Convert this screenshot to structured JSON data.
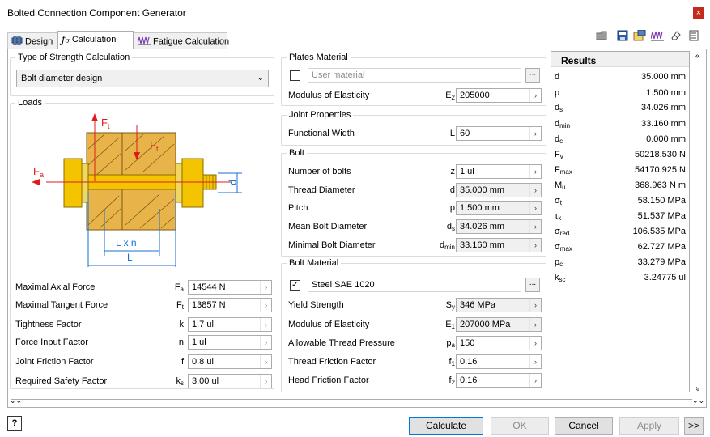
{
  "window": {
    "title": "Bolted Connection Component Generator",
    "close_icon": "×"
  },
  "tabs": [
    {
      "label": "Design",
      "icon": "design-icon"
    },
    {
      "label": "Calculation",
      "icon": "calculation-icon"
    },
    {
      "label": "Fatigue Calculation",
      "icon": "fatigue-icon"
    }
  ],
  "strength": {
    "legend": "Type of Strength Calculation",
    "selected": "Bolt diameter design"
  },
  "loads": {
    "legend": "Loads",
    "diagram": {
      "ft_top": "F",
      "ft_top_sub": "t",
      "ft_right": "F",
      "ft_right_sub": "t",
      "fa": "F",
      "fa_sub": "a",
      "p": "p",
      "lxn": "L x n",
      "l": "L"
    },
    "rows": [
      {
        "label": "Maximal Axial Force",
        "sym": "F",
        "sub": "a",
        "value": "14544 N"
      },
      {
        "label": "Maximal Tangent Force",
        "sym": "F",
        "sub": "t",
        "value": "13857 N"
      },
      {
        "label": "Tightness Factor",
        "sym": "k",
        "sub": "",
        "value": "1.7 ul"
      },
      {
        "label": "Force Input Factor",
        "sym": "n",
        "sub": "",
        "value": "1 ul"
      },
      {
        "label": "Joint Friction Factor",
        "sym": "f",
        "sub": "",
        "value": "0.8 ul"
      },
      {
        "label": "Required Safety Factor",
        "sym": "k",
        "sub": "s",
        "value": "3.00 ul"
      }
    ]
  },
  "plates": {
    "legend": "Plates Material",
    "material_placeholder": "User material",
    "modulus_label": "Modulus of Elasticity",
    "modulus_sym": "E",
    "modulus_sub": "2",
    "modulus_value": "205000"
  },
  "joint": {
    "legend": "Joint Properties",
    "label": "Functional Width",
    "sym": "L",
    "value": "60"
  },
  "bolt": {
    "legend": "Bolt",
    "rows": [
      {
        "label": "Number of bolts",
        "sym": "z",
        "sub": "",
        "value": "1 ul",
        "ro": false
      },
      {
        "label": "Thread Diameter",
        "sym": "d",
        "sub": "",
        "value": "35.000 mm",
        "ro": true
      },
      {
        "label": "Pitch",
        "sym": "p",
        "sub": "",
        "value": "1.500 mm",
        "ro": true
      },
      {
        "label": "Mean Bolt Diameter",
        "sym": "d",
        "sub": "s",
        "value": "34.026 mm",
        "ro": true
      },
      {
        "label": "Minimal Bolt Diameter",
        "sym": "d",
        "sub": "min",
        "value": "33.160 mm",
        "ro": true
      }
    ]
  },
  "bolt_material": {
    "legend": "Bolt Material",
    "material": "Steel SAE 1020",
    "rows": [
      {
        "label": "Yield Strength",
        "sym": "S",
        "sub": "y",
        "value": "346 MPa",
        "ro": true
      },
      {
        "label": "Modulus of Elasticity",
        "sym": "E",
        "sub": "1",
        "value": "207000 MPa",
        "ro": true
      },
      {
        "label": "Allowable Thread Pressure",
        "sym": "p",
        "sub": "a",
        "value": "150",
        "ro": false
      },
      {
        "label": "Thread Friction Factor",
        "sym": "f",
        "sub": "1",
        "value": "0.16",
        "ro": false
      },
      {
        "label": "Head Friction Factor",
        "sym": "f",
        "sub": "2",
        "value": "0.16",
        "ro": false
      }
    ]
  },
  "results": {
    "title": "Results",
    "rows": [
      {
        "sym": "d",
        "sub": "",
        "value": "35.000 mm"
      },
      {
        "sym": "p",
        "sub": "",
        "value": "1.500 mm"
      },
      {
        "sym": "d",
        "sub": "s",
        "value": "34.026 mm"
      },
      {
        "sym": "d",
        "sub": "min",
        "value": "33.160 mm"
      },
      {
        "sym": "d",
        "sub": "c",
        "value": "0.000 mm"
      },
      {
        "sym": "F",
        "sub": "v",
        "value": "50218.530 N"
      },
      {
        "sym": "F",
        "sub": "max",
        "value": "54170.925 N"
      },
      {
        "sym": "M",
        "sub": "u",
        "value": "368.963 N m"
      },
      {
        "sym": "σ",
        "sub": "t",
        "value": "58.150 MPa"
      },
      {
        "sym": "τ",
        "sub": "k",
        "value": "51.537 MPa"
      },
      {
        "sym": "σ",
        "sub": "red",
        "value": "106.535 MPa"
      },
      {
        "sym": "σ",
        "sub": "max",
        "value": "62.727 MPa"
      },
      {
        "sym": "p",
        "sub": "c",
        "value": "33.279 MPa"
      },
      {
        "sym": "k",
        "sub": "sc",
        "value": "3.24775 ul"
      }
    ]
  },
  "footer": {
    "help": "?",
    "calculate": "Calculate",
    "ok": "OK",
    "cancel": "Cancel",
    "apply": "Apply",
    "more": ">>"
  },
  "colors": {
    "bolt": "#f5c400",
    "plate": "#e8b44a",
    "arrow": "#e01b1b",
    "dim": "#1a6fd1"
  }
}
